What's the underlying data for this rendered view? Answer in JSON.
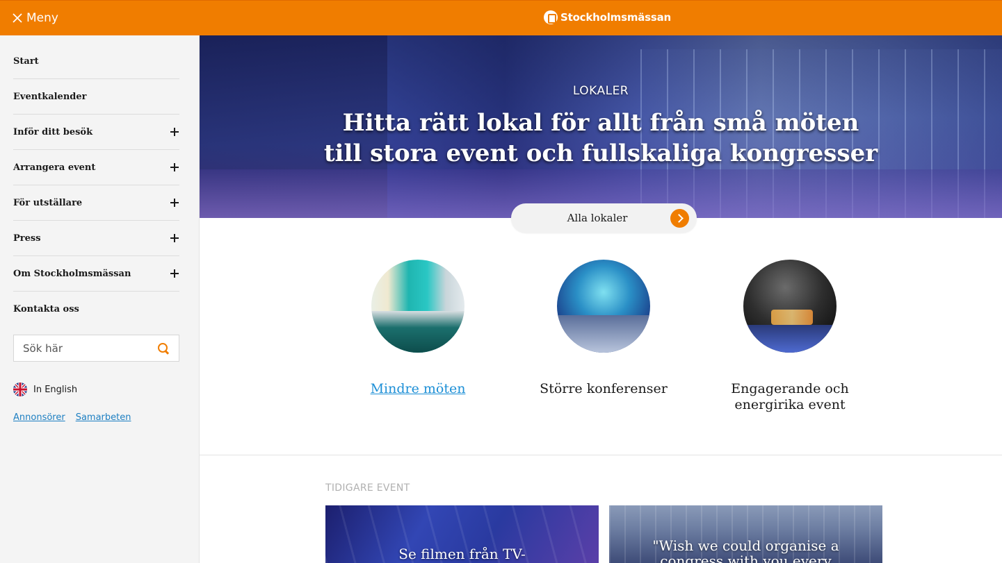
{
  "header": {
    "menu_label": "Meny",
    "logo_text": "Stockholmsmässan",
    "brand_color": "#f07d00"
  },
  "sidebar": {
    "items": [
      {
        "label": "Start",
        "expandable": false
      },
      {
        "label": "Eventkalender",
        "expandable": false
      },
      {
        "label": "Inför ditt besök",
        "expandable": true
      },
      {
        "label": "Arrangera event",
        "expandable": true
      },
      {
        "label": "För utställare",
        "expandable": true
      },
      {
        "label": "Press",
        "expandable": true
      },
      {
        "label": "Om Stockholmsmässan",
        "expandable": true
      },
      {
        "label": "Kontakta oss",
        "expandable": false
      }
    ],
    "search": {
      "placeholder": "Sök här",
      "value": ""
    },
    "language_label": "In English",
    "links": [
      "Annonsörer",
      "Samarbeten"
    ],
    "link_color": "#1d7fc2"
  },
  "hero": {
    "eyebrow": "LOKALER",
    "headline": "Hitta rätt lokal för allt från små möten till stora event och fullskaliga kongresser",
    "cta_label": "Alla lokaler"
  },
  "venues": [
    {
      "caption": "Mindre möten",
      "is_link": true
    },
    {
      "caption": "Större konferenser",
      "is_link": false
    },
    {
      "caption": "Engagerande och energirika event",
      "is_link": false
    }
  ],
  "past_events": {
    "section_label": "TIDIGARE EVENT",
    "cards": [
      {
        "title": "Se filmen från TV-"
      },
      {
        "title": "\"Wish we could organise a congress with you every"
      }
    ]
  }
}
